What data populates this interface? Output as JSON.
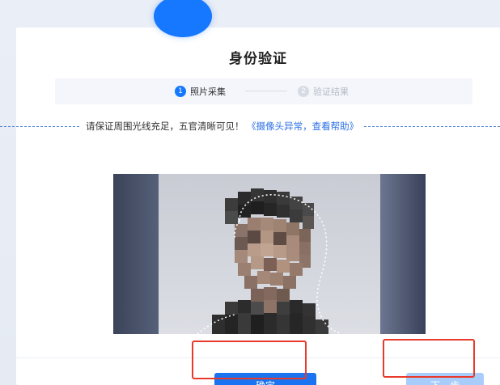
{
  "dialog": {
    "title": "身份验证"
  },
  "steps": [
    {
      "number": "1",
      "label": "照片采集",
      "state": "active"
    },
    {
      "number": "2",
      "label": "验证结果",
      "state": "inactive"
    }
  ],
  "tip": {
    "text": "请保证周围光线充足，五官清晰可见！",
    "link": "《摄像头异常，查看帮助》"
  },
  "buttons": {
    "confirm": "确定",
    "next": "下一步"
  },
  "colors": {
    "primary": "#1a73f0",
    "disabled": "#a9cdfa",
    "highlight": "#e8392a",
    "link": "#2b6fe6"
  }
}
